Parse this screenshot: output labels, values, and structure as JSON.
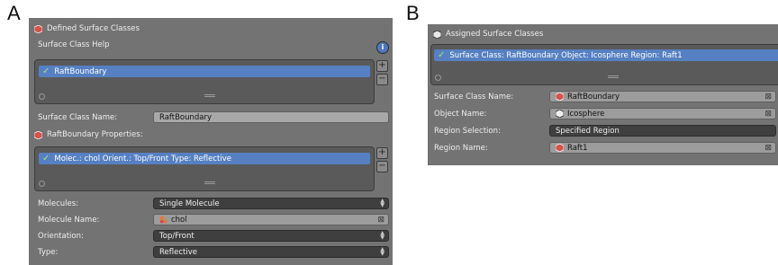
{
  "figure": {
    "label_a": "A",
    "label_b": "B"
  },
  "panel_a": {
    "header": "Defined Surface Classes",
    "help_label": "Surface Class Help",
    "list_item": "RaftBoundary",
    "name_label": "Surface Class Name:",
    "name_value": "RaftBoundary",
    "props_header": "RaftBoundary Properties:",
    "props_item": "Molec.: chol   Orient.: Top/Front   Type: Reflective",
    "molecules_label": "Molecules:",
    "molecules_value": "Single Molecule",
    "molecule_name_label": "Molecule Name:",
    "molecule_name_value": "chol",
    "orientation_label": "Orientation:",
    "orientation_value": "Top/Front",
    "type_label": "Type:",
    "type_value": "Reflective"
  },
  "panel_b": {
    "header": "Assigned Surface Classes",
    "list_item": "Surface Class: RaftBoundary   Object: Icosphere   Region: Raft1",
    "sc_name_label": "Surface Class Name:",
    "sc_name_value": "RaftBoundary",
    "object_label": "Object Name:",
    "object_value": "Icosphere",
    "region_sel_label": "Region Selection:",
    "region_sel_value": "Specified Region",
    "region_name_label": "Region Name:",
    "region_name_value": "Raft1"
  },
  "icons": [
    "cube-icon",
    "check-icon",
    "info-icon",
    "plus-icon",
    "minus-icon",
    "molecule-icon",
    "clear-icon",
    "dropdown-arrows-icon",
    "object-icon"
  ]
}
